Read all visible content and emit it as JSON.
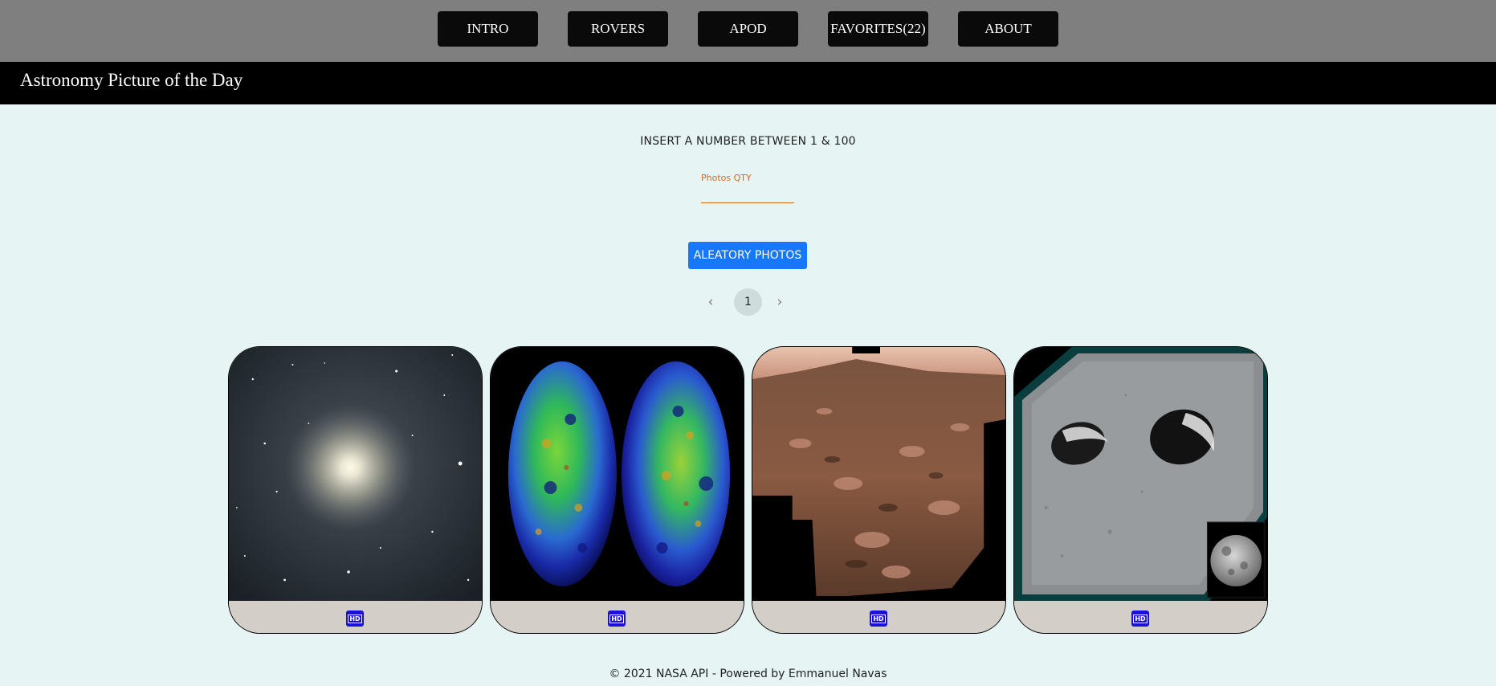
{
  "nav": {
    "items": [
      {
        "label": "INTRO"
      },
      {
        "label": "ROVERS"
      },
      {
        "label": "APOD"
      },
      {
        "label": "FAVORITES(22)"
      },
      {
        "label": "ABOUT"
      }
    ]
  },
  "header": {
    "title": "Astronomy Picture of the Day"
  },
  "form": {
    "instruction": "INSERT A NUMBER BETWEEN 1 & 100",
    "field_label": "Photos QTY",
    "field_value": "",
    "button_label": "ALEATORY PHOTOS"
  },
  "pagination": {
    "prev_icon": "‹",
    "current_page": "1",
    "next_icon": "›"
  },
  "cards": [
    {
      "image": "spiral-galaxy",
      "badge": "HD"
    },
    {
      "image": "cosmic-microwave-background",
      "badge": "HD"
    },
    {
      "image": "mars-rover-panorama",
      "badge": "HD"
    },
    {
      "image": "lunar-craters-anaglyph",
      "badge": "HD"
    }
  ],
  "footer": {
    "text": "© 2021 NASA API - Powered by Emmanuel Navas"
  },
  "colors": {
    "accent_button": "#1677ff",
    "field_accent": "#d2691e",
    "hd_badge": "#1a10d8"
  }
}
